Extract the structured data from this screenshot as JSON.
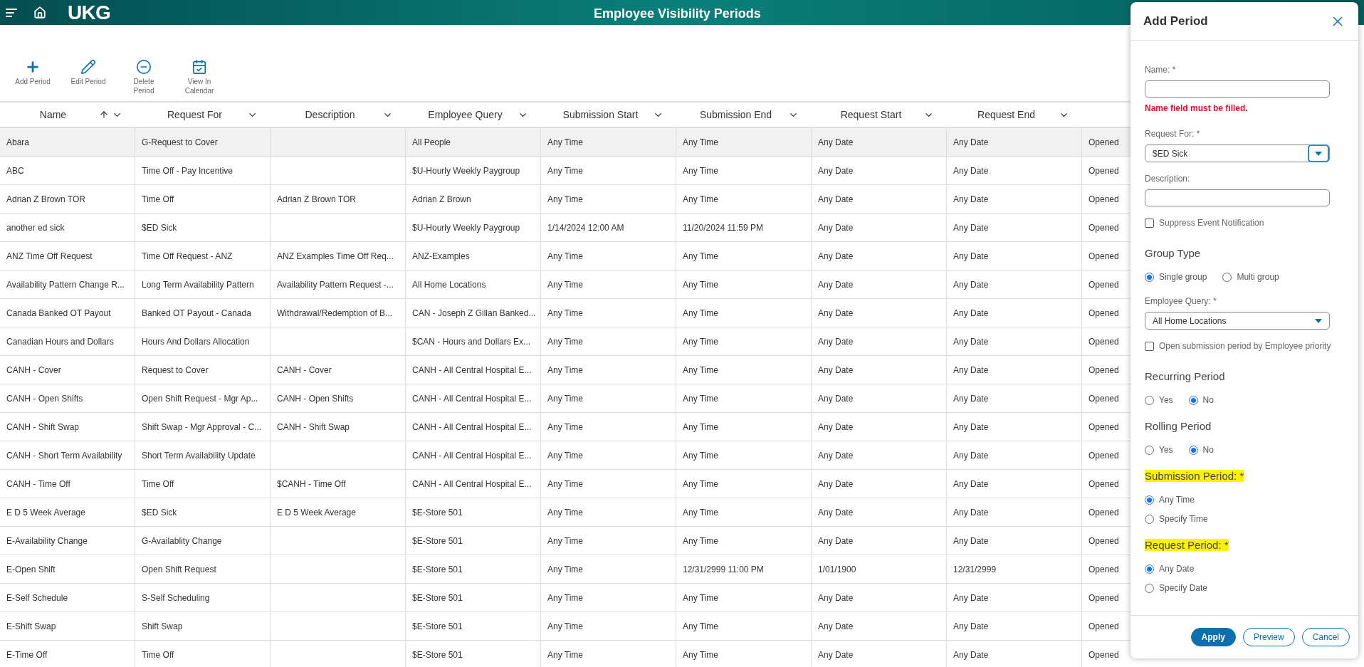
{
  "header": {
    "logo": "UKG",
    "title": "Employee Visibility Periods"
  },
  "toolbar": [
    {
      "kind": "add",
      "label": "Add Period"
    },
    {
      "kind": "edit",
      "label": "Edit Period"
    },
    {
      "kind": "delete",
      "label": "Delete Period"
    },
    {
      "kind": "calendar",
      "label": "View In Calendar"
    }
  ],
  "table": {
    "columns": [
      {
        "label": "Name",
        "sorted": true
      },
      {
        "label": "Request For",
        "sorted": false
      },
      {
        "label": "Description",
        "sorted": false
      },
      {
        "label": "Employee Query",
        "sorted": false
      },
      {
        "label": "Submission Start",
        "sorted": false
      },
      {
        "label": "Submission End",
        "sorted": false
      },
      {
        "label": "Request Start",
        "sorted": false
      },
      {
        "label": "Request End",
        "sorted": false
      }
    ],
    "rows": [
      {
        "selected": true,
        "cells": [
          "Abara",
          "G-Request to Cover",
          null,
          "All People",
          "Any Time",
          "Any Time",
          "Any Date",
          "Any Date",
          "Opened"
        ]
      },
      {
        "selected": false,
        "cells": [
          "ABC",
          "Time Off - Pay Incentive",
          null,
          "$U-Hourly Weekly Paygroup",
          "Any Time",
          "Any Time",
          "Any Date",
          "Any Date",
          "Opened"
        ]
      },
      {
        "selected": false,
        "cells": [
          "Adrian Z Brown TOR",
          "Time Off",
          "Adrian Z Brown TOR",
          "Adrian Z Brown",
          "Any Time",
          "Any Time",
          "Any Date",
          "Any Date",
          "Opened"
        ]
      },
      {
        "selected": false,
        "cells": [
          "another ed sick",
          "$ED Sick",
          null,
          "$U-Hourly Weekly Paygroup",
          "1/14/2024 12:00 AM",
          "11/20/2024 11:59 PM",
          "Any Date",
          "Any Date",
          "Opened"
        ]
      },
      {
        "selected": false,
        "cells": [
          "ANZ Time Off Request",
          "Time Off Request - ANZ",
          "ANZ Examples Time Off Req...",
          "ANZ-Examples",
          "Any Time",
          "Any Time",
          "Any Date",
          "Any Date",
          "Opened"
        ]
      },
      {
        "selected": false,
        "cells": [
          "Availability Pattern Change R...",
          "Long Term Availability Pattern",
          "Availability Pattern Request -...",
          "All Home Locations",
          "Any Time",
          "Any Time",
          "Any Date",
          "Any Date",
          "Opened"
        ]
      },
      {
        "selected": false,
        "cells": [
          "Canada Banked OT Payout",
          "Banked OT Payout - Canada",
          "Withdrawal/Redemption of B...",
          "CAN - Joseph Z Gillan Banked...",
          "Any Time",
          "Any Time",
          "Any Date",
          "Any Date",
          "Opened"
        ]
      },
      {
        "selected": false,
        "cells": [
          "Canadian Hours and Dollars",
          "Hours And Dollars Allocation",
          null,
          "$CAN - Hours and Dollars Ex...",
          "Any Time",
          "Any Time",
          "Any Date",
          "Any Date",
          "Opened"
        ]
      },
      {
        "selected": false,
        "cells": [
          "CANH - Cover",
          "Request to Cover",
          "CANH - Cover",
          "CANH - All Central Hospital E...",
          "Any Time",
          "Any Time",
          "Any Date",
          "Any Date",
          "Opened"
        ]
      },
      {
        "selected": false,
        "cells": [
          "CANH - Open Shifts",
          "Open Shift Request - Mgr Ap...",
          "CANH - Open Shifts",
          "CANH - All Central Hospital E...",
          "Any Time",
          "Any Time",
          "Any Date",
          "Any Date",
          "Opened"
        ]
      },
      {
        "selected": false,
        "cells": [
          "CANH - Shift Swap",
          "Shift Swap - Mgr Approval - C...",
          "CANH - Shift Swap",
          "CANH - All Central Hospital E...",
          "Any Time",
          "Any Time",
          "Any Date",
          "Any Date",
          "Opened"
        ]
      },
      {
        "selected": false,
        "cells": [
          "CANH - Short Term Availability",
          "Short Term Availability Update",
          null,
          "CANH - All Central Hospital E...",
          "Any Time",
          "Any Time",
          "Any Date",
          "Any Date",
          "Opened"
        ]
      },
      {
        "selected": false,
        "cells": [
          "CANH - Time Off",
          "Time Off",
          "$CANH - Time Off",
          "CANH - All Central Hospital E...",
          "Any Time",
          "Any Time",
          "Any Date",
          "Any Date",
          "Opened"
        ]
      },
      {
        "selected": false,
        "cells": [
          "E D 5 Week Average",
          "$ED Sick",
          "E D 5 Week Average",
          "$E-Store 501",
          "Any Time",
          "Any Time",
          "Any Date",
          "Any Date",
          "Opened"
        ]
      },
      {
        "selected": false,
        "cells": [
          "E-Availability Change",
          "G-Availablity Change",
          null,
          "$E-Store 501",
          "Any Time",
          "Any Time",
          "Any Date",
          "Any Date",
          "Opened"
        ]
      },
      {
        "selected": false,
        "cells": [
          "E-Open Shift",
          "Open Shift Request",
          null,
          "$E-Store 501",
          "Any Time",
          "12/31/2999 11:00 PM",
          "1/01/1900",
          "12/31/2999",
          "Opened"
        ]
      },
      {
        "selected": false,
        "cells": [
          "E-Self Schedule",
          "S-Self Scheduling",
          null,
          "$E-Store 501",
          "Any Time",
          "Any Time",
          "Any Date",
          "Any Date",
          "Opened"
        ]
      },
      {
        "selected": false,
        "cells": [
          "E-Shift Swap",
          "Shift Swap",
          null,
          "$E-Store 501",
          "Any Time",
          "Any Time",
          "Any Date",
          "Any Date",
          "Opened"
        ]
      },
      {
        "selected": false,
        "cells": [
          "E-Time Off",
          "Time Off",
          null,
          "$E-Store 501",
          "Any Time",
          "Any Time",
          "Any Date",
          "Any Date",
          "Opened"
        ]
      }
    ]
  },
  "dialog": {
    "title": "Add Period",
    "items": [
      {
        "kind": "field",
        "label": "Name: *"
      },
      {
        "kind": "error",
        "text": "Name field must be filled."
      },
      {
        "kind": "select",
        "label": "Request For: *",
        "value": "$ED Sick",
        "focused": true
      },
      {
        "kind": "field",
        "label": "Description:"
      },
      {
        "kind": "checkbox",
        "label": "Suppress Event Notification",
        "checked": false
      },
      {
        "kind": "heading",
        "text": "Group Type",
        "highlighted": false
      },
      {
        "kind": "radio_row",
        "options": [
          {
            "label": "Single group",
            "selected": true
          },
          {
            "label": "Multi group",
            "selected": false
          }
        ]
      },
      {
        "kind": "select",
        "label": "Employee Query: *",
        "value": "All Home Locations",
        "focused": false
      },
      {
        "kind": "checkbox",
        "label": "Open submission period by Employee priority",
        "checked": false
      },
      {
        "kind": "heading",
        "text": "Recurring Period",
        "highlighted": false
      },
      {
        "kind": "radio_row",
        "options": [
          {
            "label": "Yes",
            "selected": false
          },
          {
            "label": "No",
            "selected": true
          }
        ]
      },
      {
        "kind": "heading",
        "text": "Rolling Period",
        "highlighted": false
      },
      {
        "kind": "radio_row",
        "options": [
          {
            "label": "Yes",
            "selected": false
          },
          {
            "label": "No",
            "selected": true
          }
        ]
      },
      {
        "kind": "heading",
        "text": "Submission Period: *",
        "highlighted": true
      },
      {
        "kind": "radio_list",
        "options": [
          {
            "label": "Any Time",
            "selected": true
          },
          {
            "label": "Specify Time",
            "selected": false
          }
        ]
      },
      {
        "kind": "heading",
        "text": "Request Period: *",
        "highlighted": true
      },
      {
        "kind": "radio_list",
        "options": [
          {
            "label": "Any Date",
            "selected": true
          },
          {
            "label": "Specify Date",
            "selected": false
          }
        ]
      }
    ],
    "buttons": [
      {
        "label": "Apply",
        "primary": true
      },
      {
        "label": "Preview",
        "primary": false
      },
      {
        "label": "Cancel",
        "primary": false
      }
    ]
  }
}
